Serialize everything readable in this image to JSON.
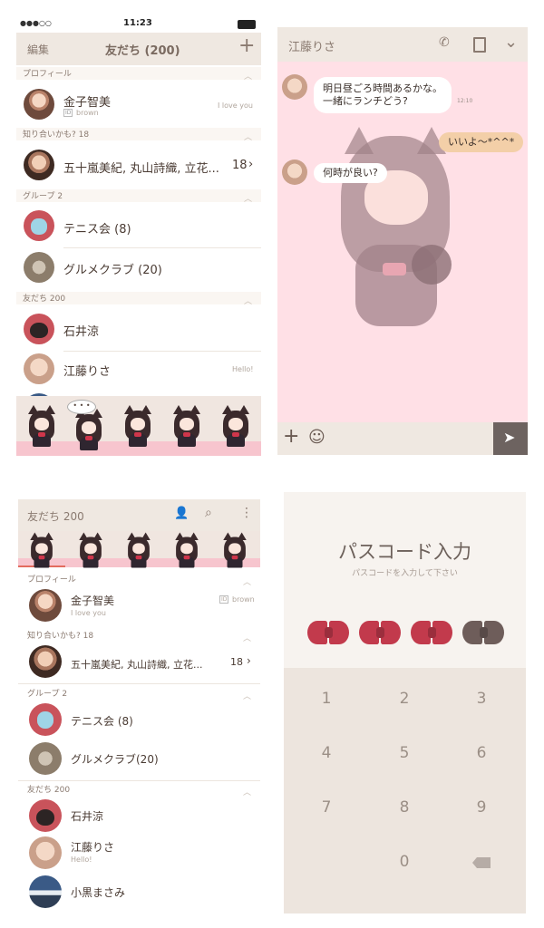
{
  "panel1": {
    "status_bar": {
      "signal": "●●●○○",
      "time": "11:23"
    },
    "nav": {
      "edit": "編集",
      "title": "友だち (200)",
      "add": "+"
    },
    "sections": {
      "profile": "プロフィール",
      "suggest": "知り合いかも? 18",
      "groups": "グループ 2",
      "friends": "友だち 200"
    },
    "profile": {
      "name": "金子智美",
      "id_badge": "ID",
      "id": "brown",
      "status": "I love you"
    },
    "suggest": {
      "names": "五十嵐美紀, 丸山詩織, 立花...",
      "count": "18"
    },
    "groups": [
      {
        "name": "テニス会 (8)"
      },
      {
        "name": "グルメクラブ (20)"
      }
    ],
    "friends": [
      {
        "name": "石井涼",
        "status": ""
      },
      {
        "name": "江藤りさ",
        "status": "Hello!"
      }
    ]
  },
  "panel2": {
    "header": {
      "title": "江藤りさ"
    },
    "messages": [
      {
        "line1": "明日昼ごろ時間あるかな。",
        "line2": "一緒にランチどう?",
        "time": "12:10"
      },
      {
        "text": "いいよ〜*^^*"
      },
      {
        "text": "何時が良い?"
      }
    ],
    "input": {
      "plus": "+",
      "emoji": "☺",
      "send": "➤"
    }
  },
  "panel3": {
    "header": {
      "title": "友だち 200"
    },
    "sections": {
      "profile": "プロフィール",
      "suggest": "知り合いかも? 18",
      "groups": "グループ 2",
      "friends": "友だち 200"
    },
    "profile": {
      "name": "金子智美",
      "status": "I love you",
      "id_badge": "ID",
      "id": "brown"
    },
    "suggest": {
      "names": "五十嵐美紀, 丸山詩織, 立花...",
      "count": "18"
    },
    "groups": [
      {
        "name": "テニス会 (8)"
      },
      {
        "name": "グルメクラブ(20)"
      }
    ],
    "friends": [
      {
        "name": "石井涼",
        "status": ""
      },
      {
        "name": "江藤りさ",
        "status": "Hello!"
      },
      {
        "name": "小黒まさみ",
        "status": ""
      }
    ]
  },
  "panel4": {
    "title": "パスコード入力",
    "subtitle": "パスコードを入力して下さい",
    "keys": [
      "1",
      "2",
      "3",
      "4",
      "5",
      "6",
      "7",
      "8",
      "9",
      "0"
    ],
    "bow_colors": [
      "#c23a4c",
      "#c23a4c",
      "#c23a4c",
      "#6e5d5a"
    ],
    "entered_count": 3
  },
  "colors": {
    "accent_red": "#c9535b",
    "chat_bg": "#ffe0e6",
    "beige": "#efe8e1"
  }
}
